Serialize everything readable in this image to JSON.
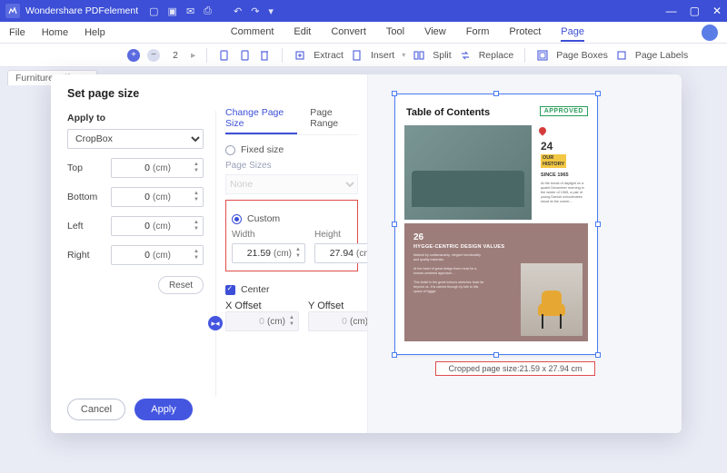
{
  "titlebar": {
    "appname": "Wondershare PDFelement"
  },
  "menubar": {
    "left": [
      "File",
      "Home",
      "Help"
    ],
    "center": [
      "Comment",
      "Edit",
      "Convert",
      "Tool",
      "View",
      "Form",
      "Protect",
      "Page"
    ],
    "active": "Page"
  },
  "ribbon": {
    "page": "2",
    "tools": {
      "extract": "Extract",
      "insert": "Insert",
      "split": "Split",
      "replace": "Replace",
      "pageboxes": "Page Boxes",
      "pagelabels": "Page Labels"
    }
  },
  "tabstrip": {
    "tab": "Furniture.pdf *"
  },
  "dialog": {
    "title": "Set page size",
    "apply_to_label": "Apply to",
    "apply_to_value": "CropBox",
    "margins": {
      "top": {
        "label": "Top",
        "value": "0",
        "unit": "(cm)"
      },
      "bottom": {
        "label": "Bottom",
        "value": "0",
        "unit": "(cm)"
      },
      "left": {
        "label": "Left",
        "value": "0",
        "unit": "(cm)"
      },
      "right": {
        "label": "Right",
        "value": "0",
        "unit": "(cm)"
      }
    },
    "reset": "Reset",
    "cancel": "Cancel",
    "apply": "Apply",
    "tabs": {
      "change": "Change Page Size",
      "range": "Page Range"
    },
    "fixed": "Fixed size",
    "page_sizes": "Page Sizes",
    "page_sizes_value": "None",
    "custom": "Custom",
    "width_label": "Width",
    "height_label": "Height",
    "width": "21.59",
    "height": "27.94",
    "unit": "(cm)",
    "center": "Center",
    "xoffset": "X Offset",
    "yoffset": "Y Offset",
    "off": "0"
  },
  "preview": {
    "title": "Table of Contents",
    "approved": "APPROVED",
    "sec24_n": "24",
    "sec24_a": "OUR",
    "sec24_b": "HISTORY",
    "sec24_c": "SINCE 1965",
    "sec26_n": "26",
    "sec26_t": "HYGGE-CENTRIC\nDESIGN VALUES",
    "cropinfo": "Cropped page size:21.59 x 27.94 cm"
  }
}
